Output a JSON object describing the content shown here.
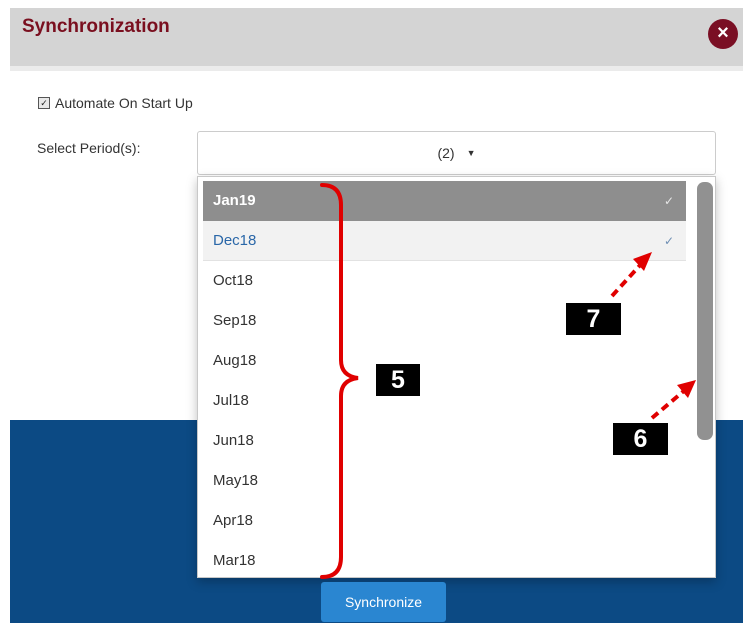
{
  "dialog": {
    "title": "Synchronization",
    "close_icon": "close-icon",
    "close_glyph": "×"
  },
  "settings": {
    "automate_label": "Automate On Start Up",
    "automate_checked": true,
    "period_label": "Select Period(s):",
    "select_value": "(2)",
    "caret_icon": "caret-down-icon"
  },
  "periods": [
    {
      "label": "Jan19",
      "selected": true,
      "highlighted": true
    },
    {
      "label": "Dec18",
      "selected": true,
      "highlighted": false
    },
    {
      "label": "Oct18",
      "selected": false,
      "highlighted": false
    },
    {
      "label": "Sep18",
      "selected": false,
      "highlighted": false
    },
    {
      "label": "Aug18",
      "selected": false,
      "highlighted": false
    },
    {
      "label": "Jul18",
      "selected": false,
      "highlighted": false
    },
    {
      "label": "Jun18",
      "selected": false,
      "highlighted": false
    },
    {
      "label": "May18",
      "selected": false,
      "highlighted": false
    },
    {
      "label": "Apr18",
      "selected": false,
      "highlighted": false
    },
    {
      "label": "Mar18",
      "selected": false,
      "highlighted": false
    }
  ],
  "check_glyph": "✓",
  "footer": {
    "sync_label": "Synchronize"
  },
  "callouts": [
    {
      "label": "5",
      "target": "period-list"
    },
    {
      "label": "6",
      "target": "scrollbar"
    },
    {
      "label": "7",
      "target": "selected-check"
    }
  ],
  "colors": {
    "title": "#7a0f1f",
    "close_button": "#7a0f24",
    "header_bg": "#d4d4d4",
    "footer_bg": "#0c4a84",
    "sync_button": "#2a86d1",
    "active_option": "#8e8e8e",
    "checked_text": "#2a67a8",
    "annotation_red": "#e00000"
  }
}
